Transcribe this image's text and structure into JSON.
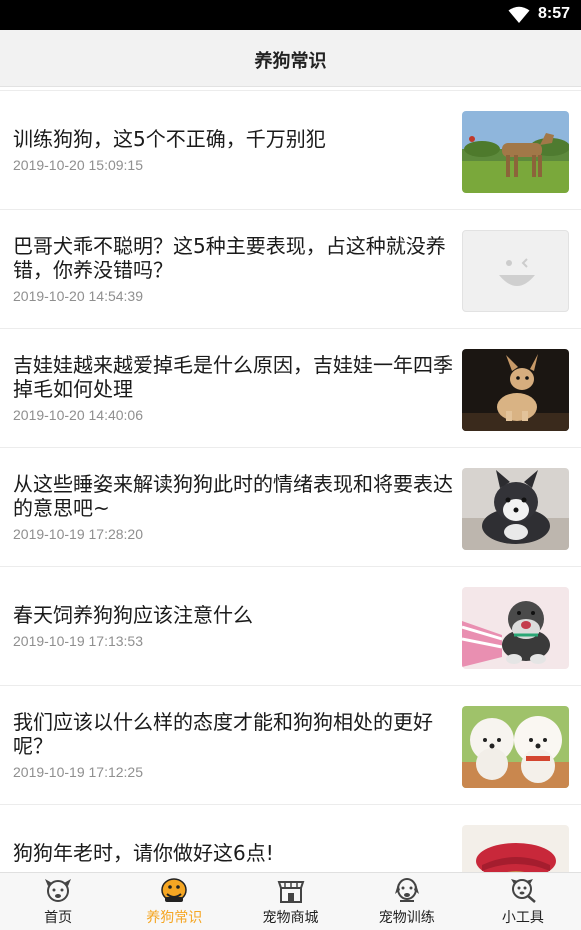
{
  "status_bar": {
    "time": "8:57",
    "wifi_icon": "wifi-icon"
  },
  "header": {
    "title": "养狗常识"
  },
  "articles": [
    {
      "title": "训练狗狗，这5个不正确，千万别犯",
      "date": "2019-10-20 15:09:15",
      "thumb": "dog-on-grass"
    },
    {
      "title": "巴哥犬乖不聪明？这5种主要表现，占这种就没养错，你养没错吗？",
      "date": "2019-10-20 14:54:39",
      "thumb": "placeholder-face"
    },
    {
      "title": "吉娃娃越来越爱掉毛是什么原因，吉娃娃一年四季掉毛如何处理",
      "date": "2019-10-20 14:40:06",
      "thumb": "chihuahua"
    },
    {
      "title": "从这些睡姿来解读狗狗此时的情绪表现和将要表达的意思吧~",
      "date": "2019-10-19 17:28:20",
      "thumb": "husky-puppy"
    },
    {
      "title": "春天饲养狗狗应该注意什么",
      "date": "2019-10-19 17:13:53",
      "thumb": "schnauzer"
    },
    {
      "title": "我们应该以什么样的态度才能和狗狗相处的更好呢？",
      "date": "2019-10-19 17:12:25",
      "thumb": "two-bichons"
    },
    {
      "title": "狗狗年老时，请你做好这6点!",
      "date": "",
      "thumb": "dog-red-hat"
    }
  ],
  "bottom_nav": [
    {
      "label": "首页",
      "icon": "dog-face-icon",
      "active": false
    },
    {
      "label": "养狗常识",
      "icon": "dog-knowledge-icon",
      "active": true
    },
    {
      "label": "宠物商城",
      "icon": "shop-icon",
      "active": false
    },
    {
      "label": "宠物训练",
      "icon": "dog-training-icon",
      "active": false
    },
    {
      "label": "小工具",
      "icon": "tool-dog-icon",
      "active": false
    }
  ],
  "colors": {
    "active": "#f5a623",
    "inactive_text": "#222222",
    "date_text": "#8f8f8f",
    "header_bg": "#f2f2f2"
  }
}
